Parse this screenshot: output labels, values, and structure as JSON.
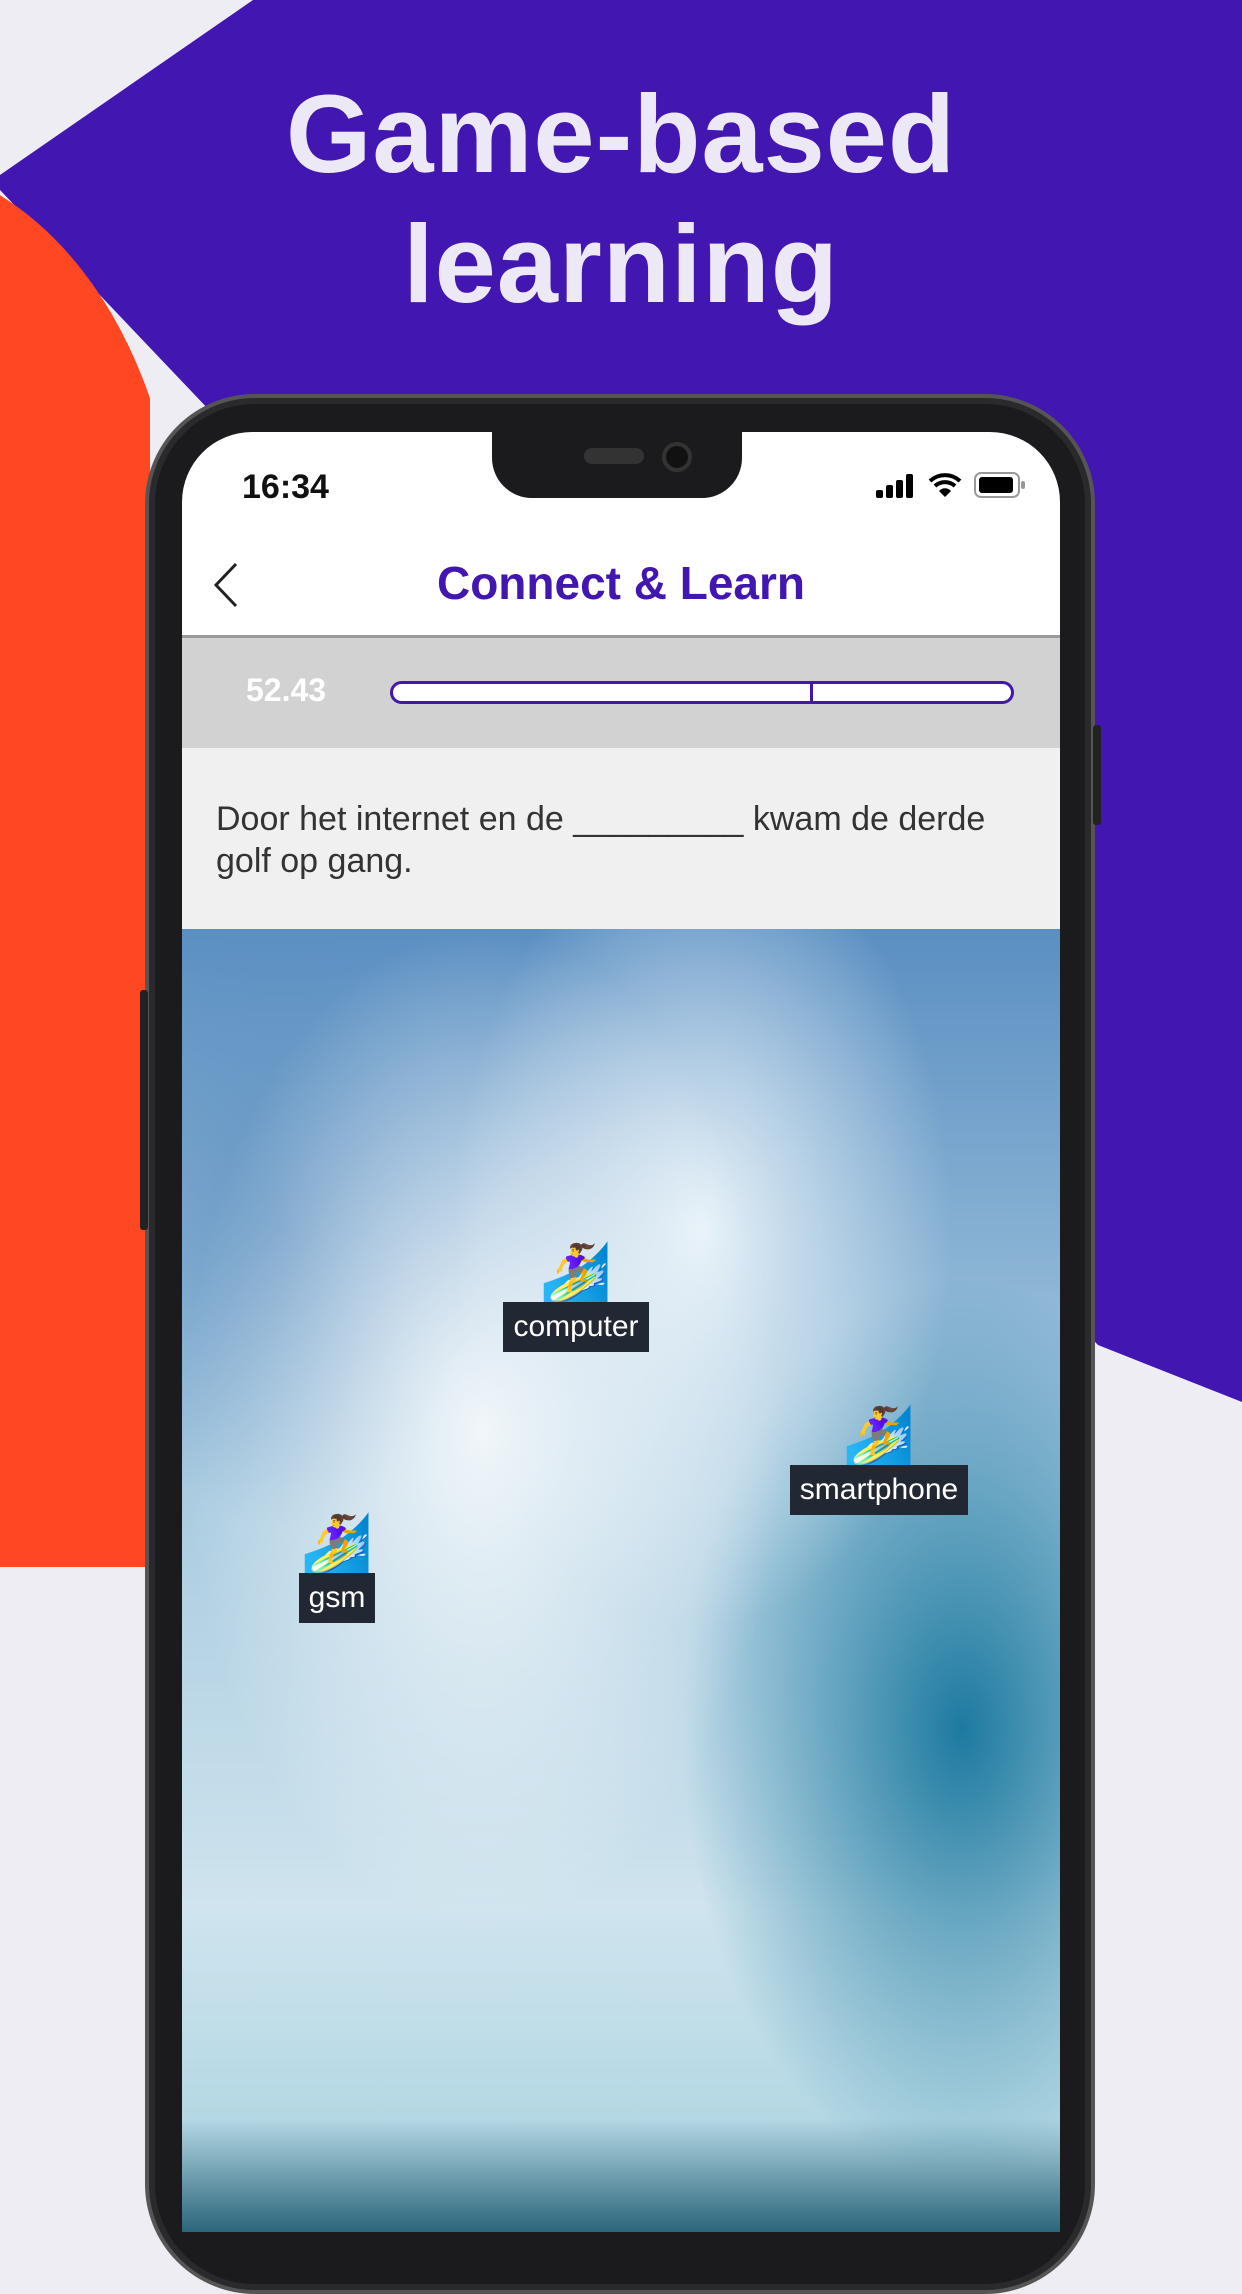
{
  "headline": {
    "line1": "Game-based",
    "line2": "learning"
  },
  "colors": {
    "brand_purple": "#4216b0",
    "accent_orange": "#ff4722",
    "background": "#eeedf3"
  },
  "status_bar": {
    "time": "16:34",
    "icons": [
      "signal-icon",
      "wifi-icon",
      "battery-icon"
    ]
  },
  "nav": {
    "back_icon": "chevron-left-icon",
    "title": "Connect & Learn"
  },
  "timer": {
    "value": "52.43",
    "progress_percent": 67.5
  },
  "question": {
    "text": "Door het internet en de _________ kwam de derde golf op gang."
  },
  "answers": [
    {
      "label": "computer",
      "icon": "surfer-emoji",
      "glyph": "🏄‍♀️"
    },
    {
      "label": "smartphone",
      "icon": "surfer-emoji",
      "glyph": "🏄‍♀️"
    },
    {
      "label": "gsm",
      "icon": "surfer-emoji",
      "glyph": "🏄‍♀️"
    }
  ]
}
